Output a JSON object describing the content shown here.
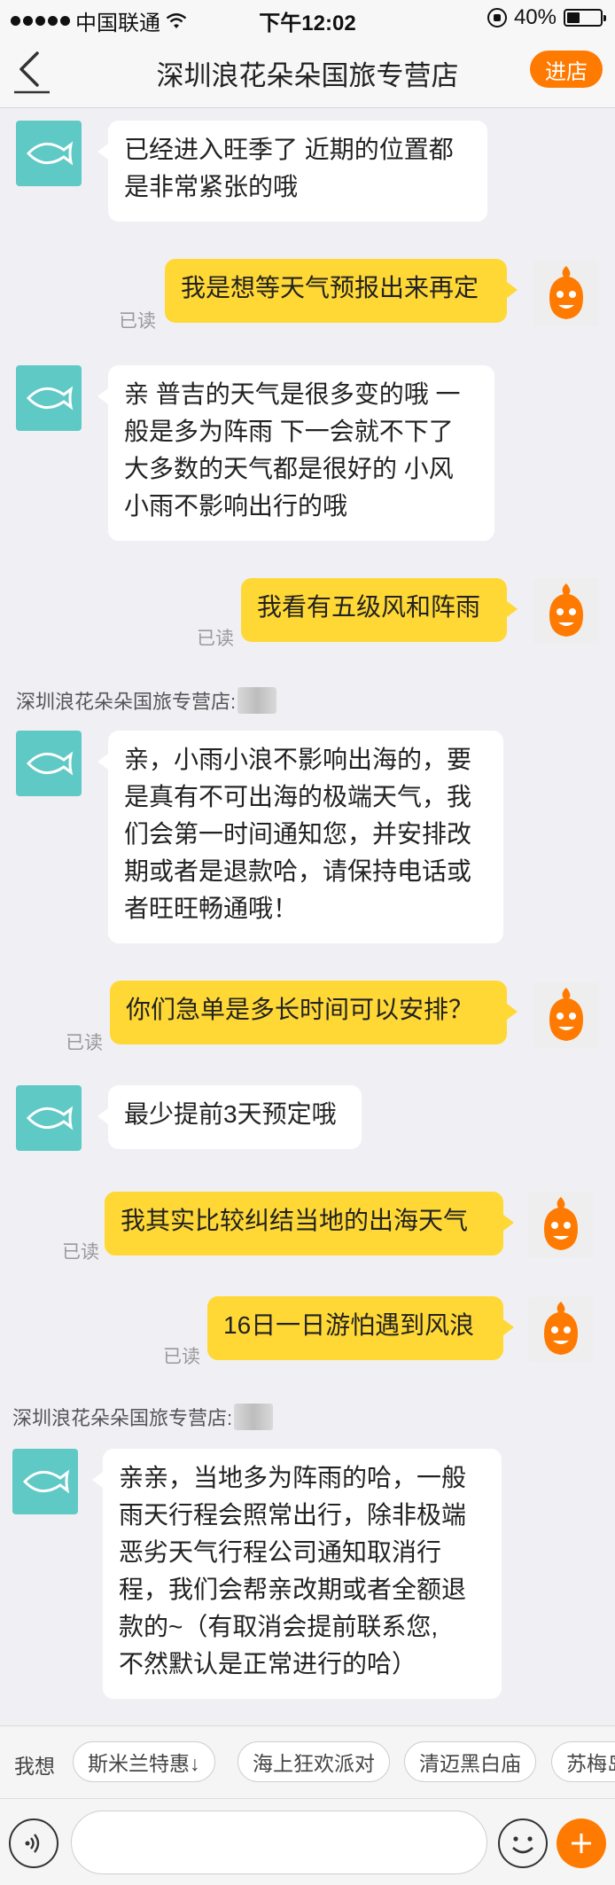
{
  "status_bar": {
    "carrier": "中国联通",
    "time": "下午12:02",
    "battery": "40%",
    "battery_level": 0.4
  },
  "header": {
    "title": "深圳浪花朵朵国旅专营店",
    "enter_label": "进店"
  },
  "messages": {
    "m1": {
      "line1": "已经进入旺季了 近期的位置都",
      "line2": "是非常紧张的哦"
    },
    "m2": {
      "text": "我是想等天气预报出来再定",
      "read": "已读"
    },
    "m3": {
      "line1": "亲 普吉的天气是很多变的哦 一",
      "line2": "般是多为阵雨 下一会就不下了",
      "line3": "大多数的天气都是很好的 小风",
      "line4": "小雨不影响出行的哦"
    },
    "m4": {
      "text": "我看有五级风和阵雨",
      "read": "已读"
    },
    "sender1": "深圳浪花朵朵国旅专营店:",
    "m5": {
      "line1": "亲，小雨小浪不影响出海的，要",
      "line2": "是真有不可出海的极端天气，我",
      "line3": "们会第一时间通知您，并安排改",
      "line4": "期或者是退款哈，请保持电话或",
      "line5": "者旺旺畅通哦！"
    },
    "m6": {
      "text": "你们急单是多长时间可以安排？",
      "read": "已读"
    },
    "m7": {
      "text": "最少提前3天预定哦"
    },
    "m8": {
      "text": "我其实比较纠结当地的出海天气",
      "read": "已读"
    },
    "m9": {
      "text": "16日一日游怕遇到风浪",
      "read": "已读"
    },
    "sender2": "深圳浪花朵朵国旅专营店:",
    "m10": {
      "line1": "亲亲，当地多为阵雨的哈，一般",
      "line2": "雨天行程会照常出行，除非极端",
      "line3": "恶劣天气行程公司通知取消行",
      "line4": "程，我们会帮亲改期或者全额退",
      "line5": "款的~（有取消会提前联系您,",
      "line6": "不然默认是正常进行的哈）"
    }
  },
  "suggestions": {
    "label": "我想",
    "chip1": "斯米兰特惠↓",
    "chip2": "海上狂欢派对",
    "chip3": "清迈黑白庙",
    "chip4": "苏梅岛"
  },
  "colors": {
    "accent": "#ff7a00",
    "user_bubble": "#ffd835",
    "shop_avatar": "#5fc9c6",
    "background": "#f0eff4"
  },
  "icons": {
    "back": "back-chevron-icon",
    "voice": "voice-icon",
    "emoji": "emoji-icon",
    "plus": "plus-icon",
    "shop_avatar": "fish-icon",
    "user_avatar": "orange-mascot-icon"
  }
}
